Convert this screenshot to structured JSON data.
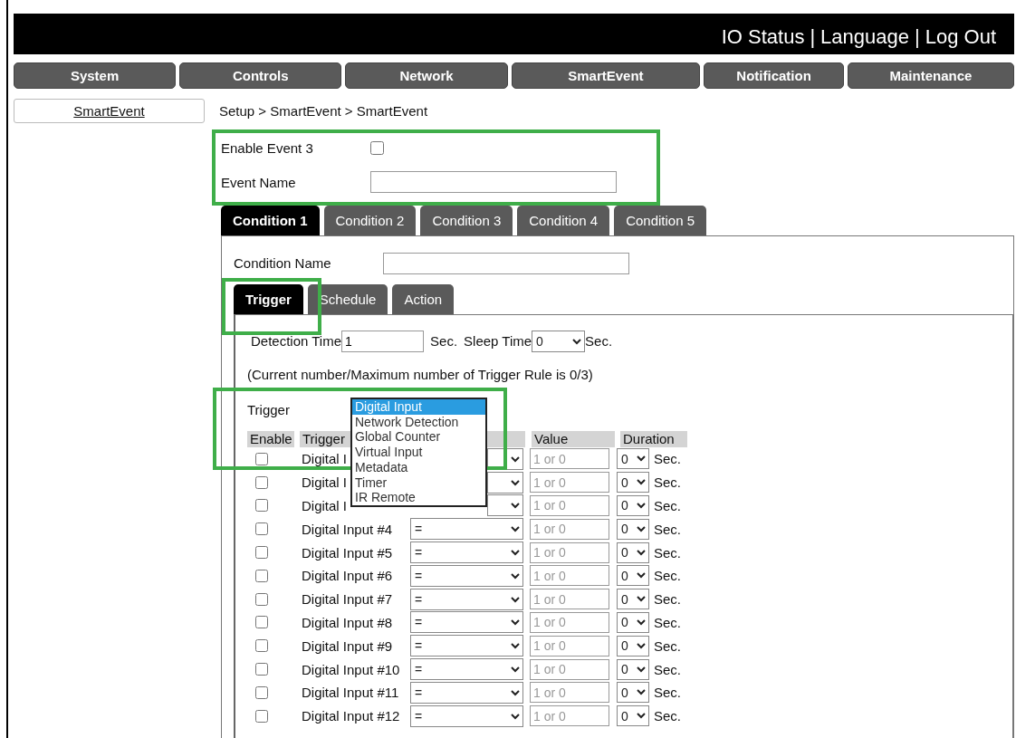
{
  "header": {
    "links": [
      "IO Status",
      "|",
      "Language",
      "|",
      "Log Out"
    ]
  },
  "nav": [
    {
      "label": "System",
      "selected": false
    },
    {
      "label": "Controls",
      "selected": false
    },
    {
      "label": "Network",
      "selected": false
    },
    {
      "label": "SmartEvent",
      "selected": false
    },
    {
      "label": "Notification",
      "selected": false
    },
    {
      "label": "Maintenance",
      "selected": false
    }
  ],
  "sidebar": {
    "items": [
      {
        "label": "SmartEvent",
        "selected": true
      }
    ]
  },
  "breadcrumb": "Setup > SmartEvent > SmartEvent",
  "event": {
    "enable_label": "Enable Event 3",
    "enabled": false,
    "name_label": "Event Name"
  },
  "condition_tabs": [
    {
      "label": "Condition 1",
      "selected": true
    },
    {
      "label": "Condition 2",
      "selected": false
    },
    {
      "label": "Condition 3",
      "selected": false
    },
    {
      "label": "Condition 4",
      "selected": false
    },
    {
      "label": "Condition 5",
      "selected": false
    }
  ],
  "condition_name_label": "Condition Name",
  "sub_tabs": [
    {
      "label": "Trigger",
      "selected": true
    },
    {
      "label": "Schedule",
      "selected": false
    },
    {
      "label": "Action",
      "selected": false
    }
  ],
  "detection": {
    "label": "Detection Time",
    "value": "1",
    "unit": "Sec.",
    "sleep_label": "Sleep Time",
    "sleep_value": "0",
    "sleep_unit": "Sec."
  },
  "rule_count": "(Current number/Maximum number of Trigger Rule is 0/3)",
  "trigger": {
    "label": "Trigger",
    "options": [
      {
        "label": "Digital Input",
        "selected": true
      },
      {
        "label": "Network Detection",
        "selected": false
      },
      {
        "label": "Global Counter",
        "selected": false
      },
      {
        "label": "Virtual Input",
        "selected": false
      },
      {
        "label": "Metadata",
        "selected": false
      },
      {
        "label": "Timer",
        "selected": false
      },
      {
        "label": "IR Remote",
        "selected": false
      }
    ]
  },
  "table": {
    "columns": [
      "Enable",
      "Trigger",
      "Value",
      "Duration"
    ],
    "rows": [
      {
        "enabled": false,
        "name": "Digital I",
        "value_placeholder": "1 or 0",
        "duration": "0",
        "unit": "Sec."
      },
      {
        "enabled": false,
        "name": "Digital I",
        "value_placeholder": "1 or 0",
        "duration": "0",
        "unit": "Sec."
      },
      {
        "enabled": false,
        "name": "Digital I",
        "value_placeholder": "1 or 0",
        "duration": "0",
        "unit": "Sec."
      },
      {
        "enabled": false,
        "name": "Digital Input #4",
        "operator": "=",
        "value_placeholder": "1 or 0",
        "duration": "0",
        "unit": "Sec."
      },
      {
        "enabled": false,
        "name": "Digital Input #5",
        "operator": "=",
        "value_placeholder": "1 or 0",
        "duration": "0",
        "unit": "Sec."
      },
      {
        "enabled": false,
        "name": "Digital Input #6",
        "operator": "=",
        "value_placeholder": "1 or 0",
        "duration": "0",
        "unit": "Sec."
      },
      {
        "enabled": false,
        "name": "Digital Input #7",
        "operator": "=",
        "value_placeholder": "1 or 0",
        "duration": "0",
        "unit": "Sec."
      },
      {
        "enabled": false,
        "name": "Digital Input #8",
        "operator": "=",
        "value_placeholder": "1 or 0",
        "duration": "0",
        "unit": "Sec."
      },
      {
        "enabled": false,
        "name": "Digital Input #9",
        "operator": "=",
        "value_placeholder": "1 or 0",
        "duration": "0",
        "unit": "Sec."
      },
      {
        "enabled": false,
        "name": "Digital Input #10",
        "operator": "=",
        "value_placeholder": "1 or 0",
        "duration": "0",
        "unit": "Sec."
      },
      {
        "enabled": false,
        "name": "Digital Input #11",
        "operator": "=",
        "value_placeholder": "1 or 0",
        "duration": "0",
        "unit": "Sec."
      },
      {
        "enabled": false,
        "name": "Digital Input #12",
        "operator": "=",
        "value_placeholder": "1 or 0",
        "duration": "0",
        "unit": "Sec."
      }
    ]
  }
}
